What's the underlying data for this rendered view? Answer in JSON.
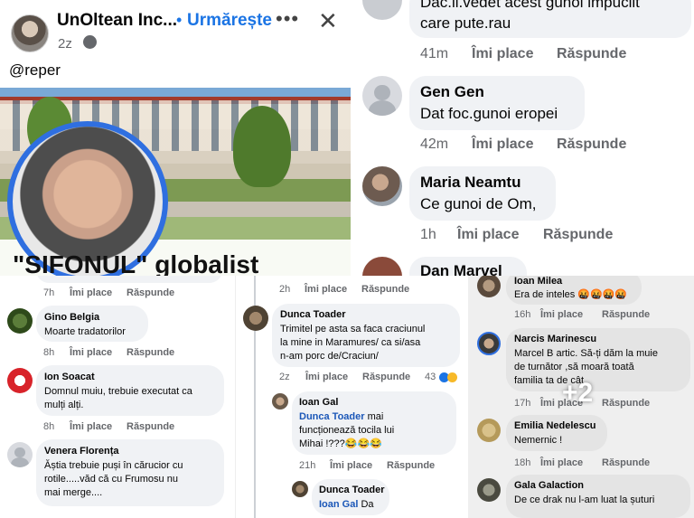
{
  "post": {
    "page_name": "UnOltean Inc...",
    "follow_label": "Urmărește",
    "more_icon": "more-icon",
    "close_icon": "close-icon",
    "time": "2z",
    "audience_icon": "globe-icon",
    "text": "@reper",
    "image_headline": "\"SIFONUL\" globalist"
  },
  "top_comments": [
    {
      "name": "",
      "text_line1": "Dac.il.vedet acest gunoi impucilt",
      "text_line2": "care pute.rau",
      "time": "41m",
      "like": "Îmi place",
      "reply": "Răspunde"
    },
    {
      "name": "Gen Gen",
      "text": "Dat foc.gunoi eropei",
      "time": "42m",
      "like": "Îmi place",
      "reply": "Răspunde"
    },
    {
      "name": "Maria Neamtu",
      "text": "Ce gunoi de Om,",
      "time": "1h",
      "like": "Îmi place",
      "reply": "Răspunde"
    },
    {
      "name": "Dan Marvel"
    }
  ],
  "left_comments": [
    {
      "time": "7h",
      "like": "Îmi place",
      "reply": "Răspunde"
    },
    {
      "name": "Gino Belgia",
      "text": "Moarte tradatorilor",
      "time": "8h",
      "like": "Îmi place",
      "reply": "Răspunde"
    },
    {
      "name": "Ion Soacat",
      "text_line1": "Domnul muiu, trebuie executat ca",
      "text_line2": "mulți alți.",
      "time": "8h",
      "like": "Îmi place",
      "reply": "Răspunde"
    },
    {
      "name": "Venera Florența",
      "text_line1": "Ăștia trebuie puși în cărucior  cu",
      "text_line2": "rotile.....văd că cu Frumosu nu",
      "text_line3": "mai merge...."
    }
  ],
  "middle_comments": [
    {
      "time": "2h",
      "like": "Îmi place",
      "reply": "Răspunde"
    },
    {
      "name": "Dunca Toader",
      "text_line1": "Trimitel pe asta sa faca craciunul",
      "text_line2": "la mine in Maramures/ ca si/asa",
      "text_line3": "n-am porc de/Craciun/",
      "time": "2z",
      "like": "Îmi place",
      "reply": "Răspunde",
      "reactions": "43"
    },
    {
      "name": "Ioan Gal",
      "mention": "Dunca Toader",
      "text_line1": " mai",
      "text_line2": "funcționează tocila lui",
      "text_line3": "Mihai !???😂😂😂",
      "time": "21h",
      "like": "Îmi place",
      "reply": "Răspunde"
    },
    {
      "name": "Dunca Toader",
      "mention": "Ioan Gal",
      "text": " Da"
    }
  ],
  "right_comments": [
    {
      "name": "Ioan Milea",
      "text": "Era de inteles 🤬🤬🤬🤬",
      "time": "16h",
      "like": "Îmi place",
      "reply": "Răspunde"
    },
    {
      "name": "Narcis Marinescu",
      "text_line1": "Marcel B artic. Să-ți dăm la muie",
      "text_line2": "de turnător ,să moară toată",
      "text_line3": "familia ta de cât",
      "time": "17h",
      "like": "Îmi place",
      "reply": "Răspunde",
      "overlay": "+2"
    },
    {
      "name": "Emilia Nedelescu",
      "text": "Nemernic !",
      "time": "18h",
      "like": "Îmi place",
      "reply": "Răspunde"
    },
    {
      "name": "Gala Galaction",
      "text": "De ce drak nu l-am luat la șuturi"
    }
  ],
  "colors": {
    "link": "#1b74e4",
    "meta": "#65676b",
    "bubble": "#f0f2f5",
    "frame": "#2f6fe0"
  }
}
